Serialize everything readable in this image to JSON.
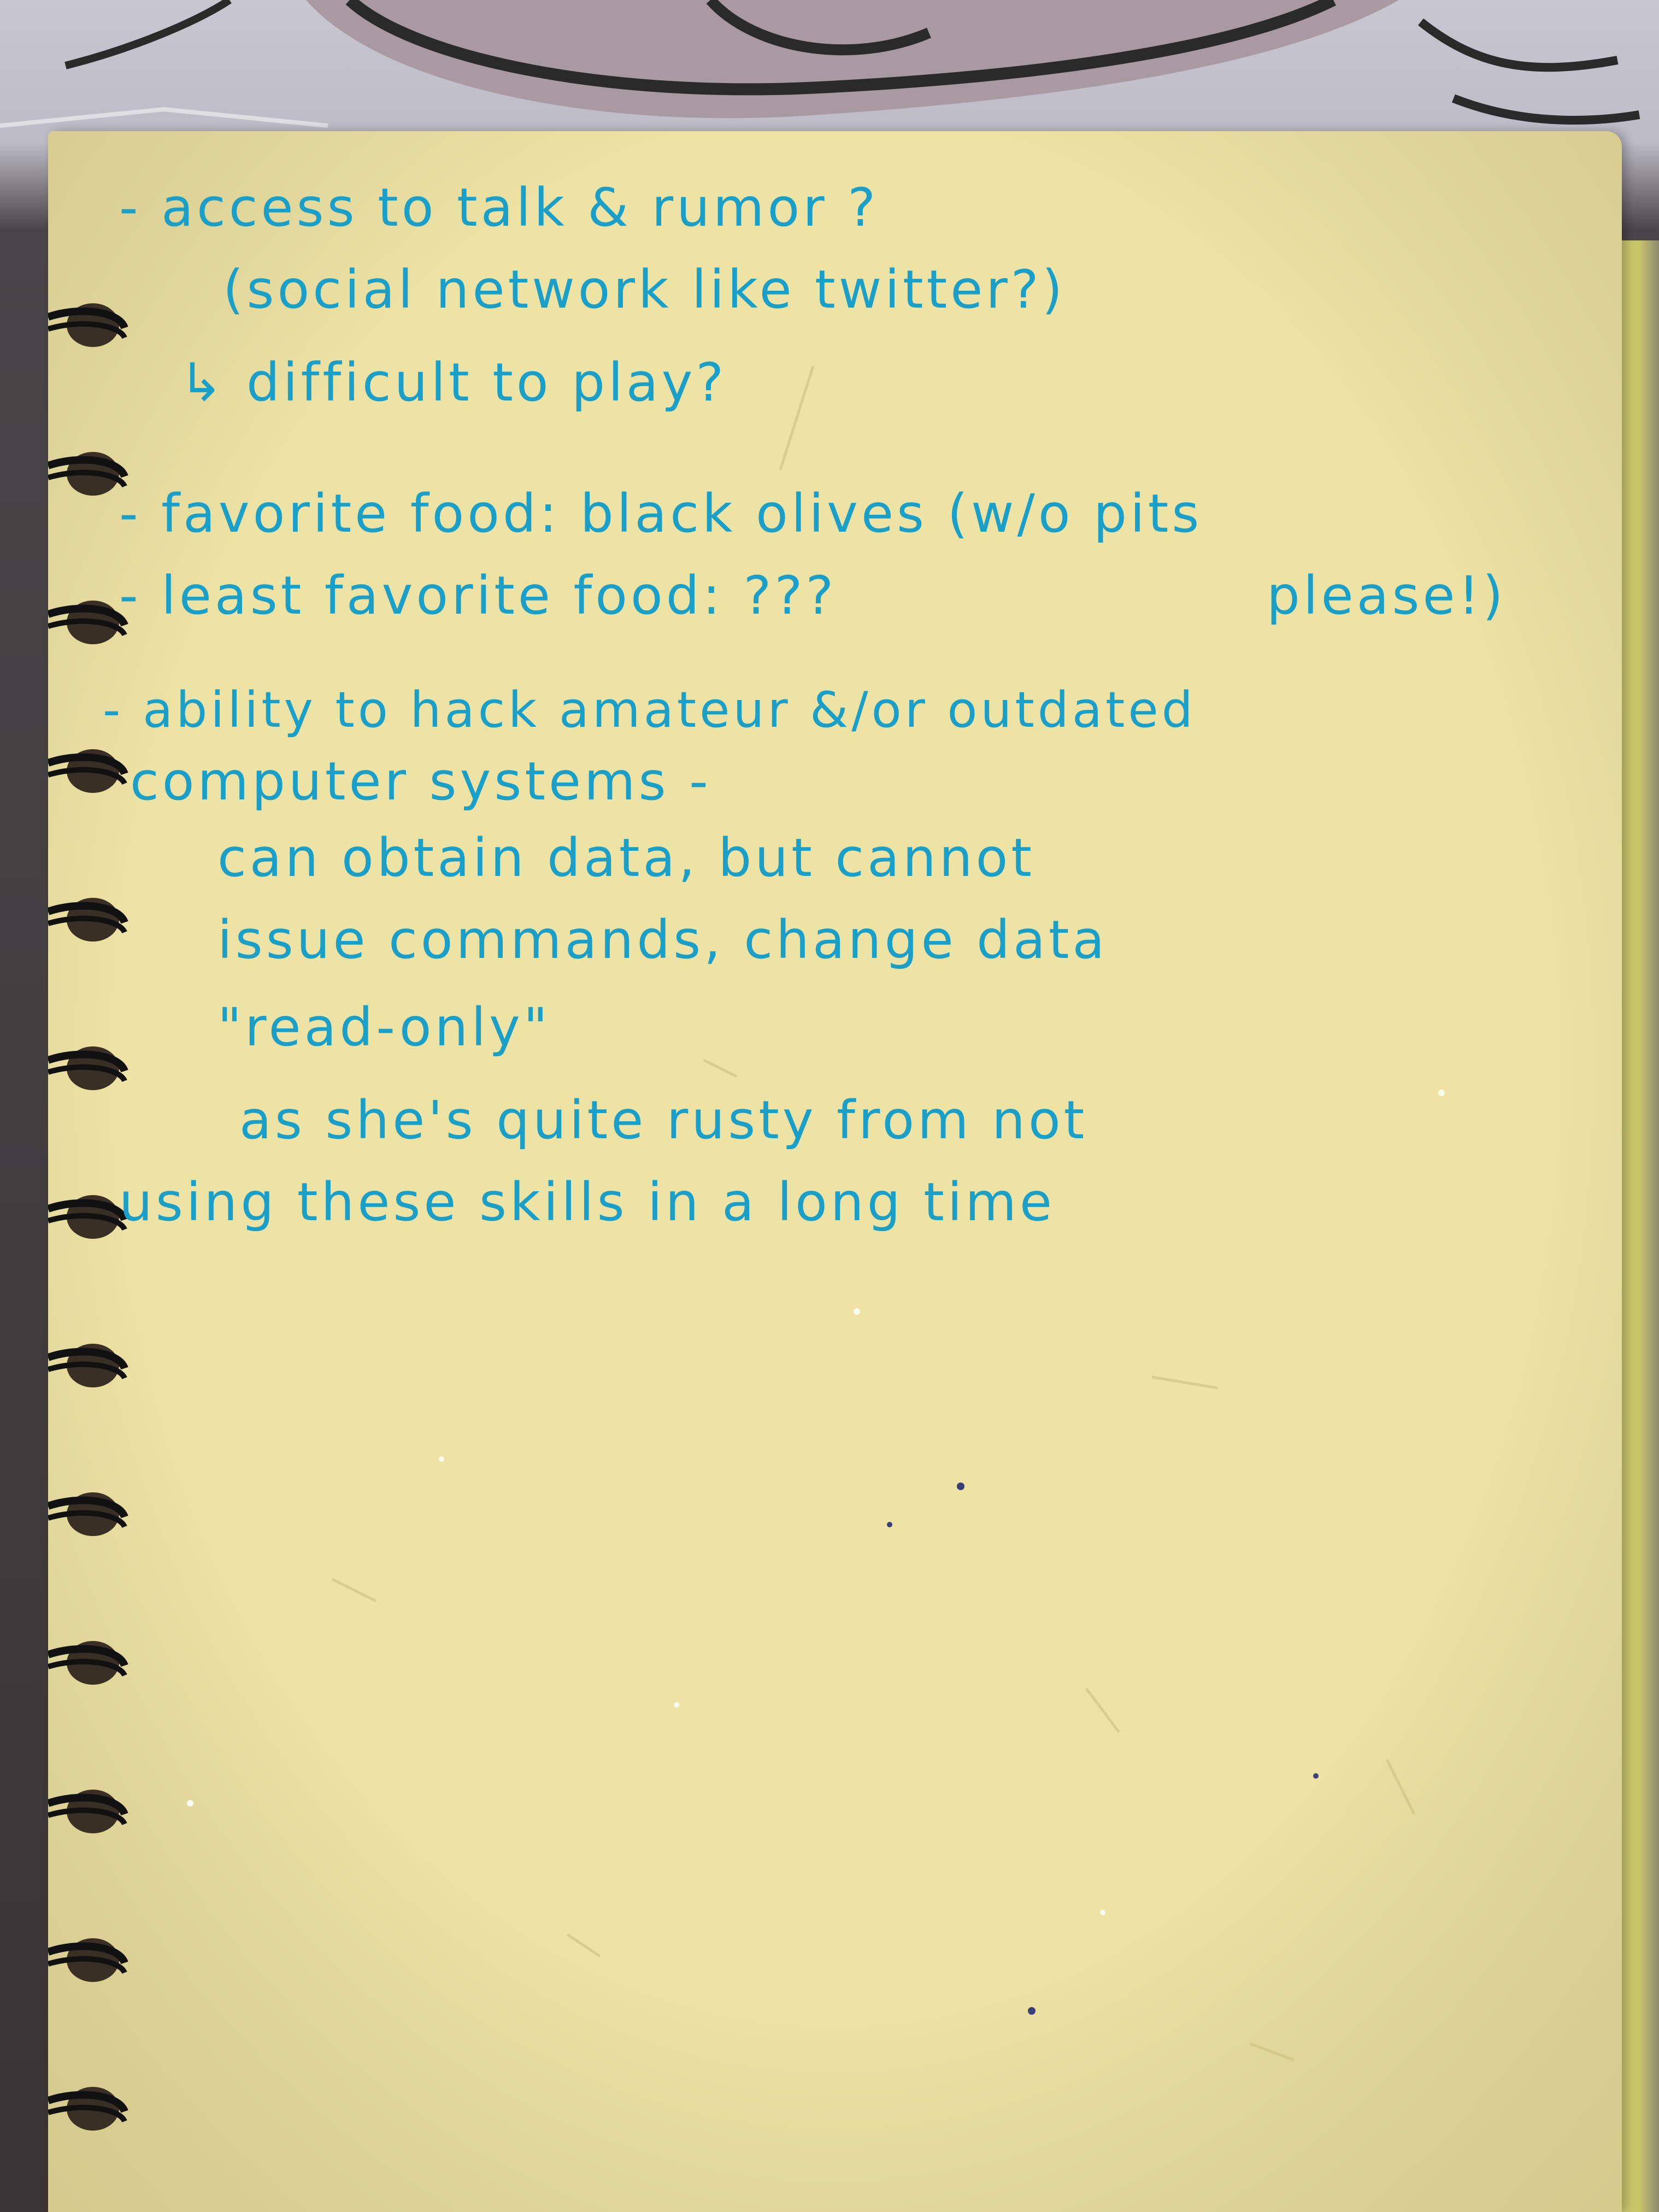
{
  "colors": {
    "ink": "#1a9fc9",
    "paper": "#ede3a4",
    "binding_wire": "#111111"
  },
  "note_lines": [
    "- access to talk & rumor ?",
    "(social network like twitter?)",
    "↳ difficult to play?",
    "- favorite food: black olives (w/o pits",
    "- least favorite food: ???",
    "please!)",
    "- ability to hack amateur &/or outdated",
    "computer systems -",
    "can obtain data, but cannot",
    "issue commands, change data",
    "\"read-only\"",
    "as she's quite rusty from not",
    "using these skills in a long time"
  ]
}
